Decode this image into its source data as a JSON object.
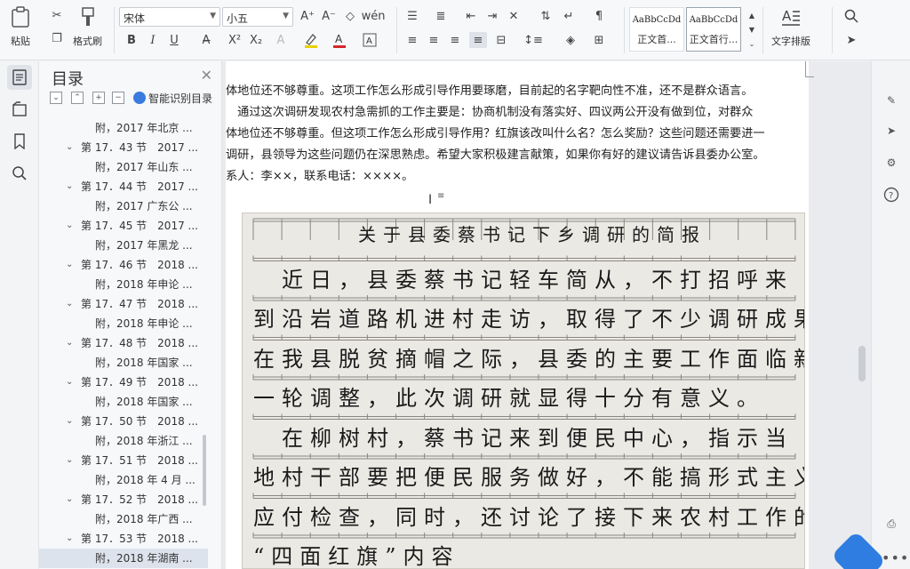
{
  "ribbon": {
    "paste_label": "粘贴",
    "format_painter_label": "格式刷",
    "font_name": "宋体",
    "font_size": "小五",
    "style_normal_sample": "AaBbCcDd",
    "style_normal_label": "正文首...",
    "style_body_sample": "AaBbCcDd",
    "style_body_label": "正文首行...",
    "text_layout_label": "文字排版"
  },
  "toc": {
    "title": "目录",
    "smart_label": "智能识别目录",
    "items": [
      {
        "level": 2,
        "text": "附，2017 年北京 ..."
      },
      {
        "level": 1,
        "text": "第 17．43 节　2017 ..."
      },
      {
        "level": 2,
        "text": "附，2017 年山东 ..."
      },
      {
        "level": 1,
        "text": "第 17．44 节　2017 ..."
      },
      {
        "level": 2,
        "text": "附，2017 广东公 ..."
      },
      {
        "level": 1,
        "text": "第 17．45 节　2017 ..."
      },
      {
        "level": 2,
        "text": "附，2017 年黑龙 ..."
      },
      {
        "level": 1,
        "text": "第 17．46 节　2018 ..."
      },
      {
        "level": 2,
        "text": "附，2018 年申论 ..."
      },
      {
        "level": 1,
        "text": "第 17．47 节　2018 ..."
      },
      {
        "level": 2,
        "text": "附，2018 年申论 ..."
      },
      {
        "level": 1,
        "text": "第 17．48 节　2018 ..."
      },
      {
        "level": 2,
        "text": "附，2018 年国家 ..."
      },
      {
        "level": 1,
        "text": "第 17．49 节　2018 ..."
      },
      {
        "level": 2,
        "text": "附，2018 年国家 ..."
      },
      {
        "level": 1,
        "text": "第 17．50 节　2018 ..."
      },
      {
        "level": 2,
        "text": "附，2018 年浙江 ..."
      },
      {
        "level": 1,
        "text": "第 17．51 节　2018 ..."
      },
      {
        "level": 2,
        "text": "附，2018 年 4 月 ..."
      },
      {
        "level": 1,
        "text": "第 17．52 节　2018 ..."
      },
      {
        "level": 2,
        "text": "附，2018 年广西 ..."
      },
      {
        "level": 1,
        "text": "第 17．53 节　2018 ..."
      },
      {
        "level": 2,
        "text": "附，2018 年湖南 ...",
        "selected": true
      }
    ]
  },
  "document": {
    "lines": [
      "体地位还不够尊重。这项工作怎么形成引导作用要琢磨，目前起的名字靶向性不准，还不是群众语言。",
      "　通过这次调研发现农村急需抓的工作主要是：协商机制没有落实好、四议两公开没有做到位，对群众",
      "体地位还不够尊重。但这项工作怎么形成引导作用？红旗该改叫什么名？怎么奖励？这些问题还需要进一",
      "调研，县领导为这些问题仍在深思熟虑。希望大家积极建言献策，如果你有好的建议请告诉县委办公室。",
      "系人：李××，联系电话：××××。"
    ],
    "handwriting": [
      "关于县委蔡书记下乡调研的简报",
      "　近日，县委蔡书记轻车简从，不打招呼来",
      "到沿岩道路机进村走访，取得了不少调研成果。",
      "在我县脱贫摘帽之际，县委的主要工作面临新",
      "一轮调整，此次调研就显得十分有意义。",
      "　在柳树村，蔡书记来到便民中心，指示当",
      "地村干部要把便民服务做好，不能搞形式主义",
      "应付检查，同时，还讨论了接下来农村工作的",
      "“四面红旗”内容"
    ]
  }
}
